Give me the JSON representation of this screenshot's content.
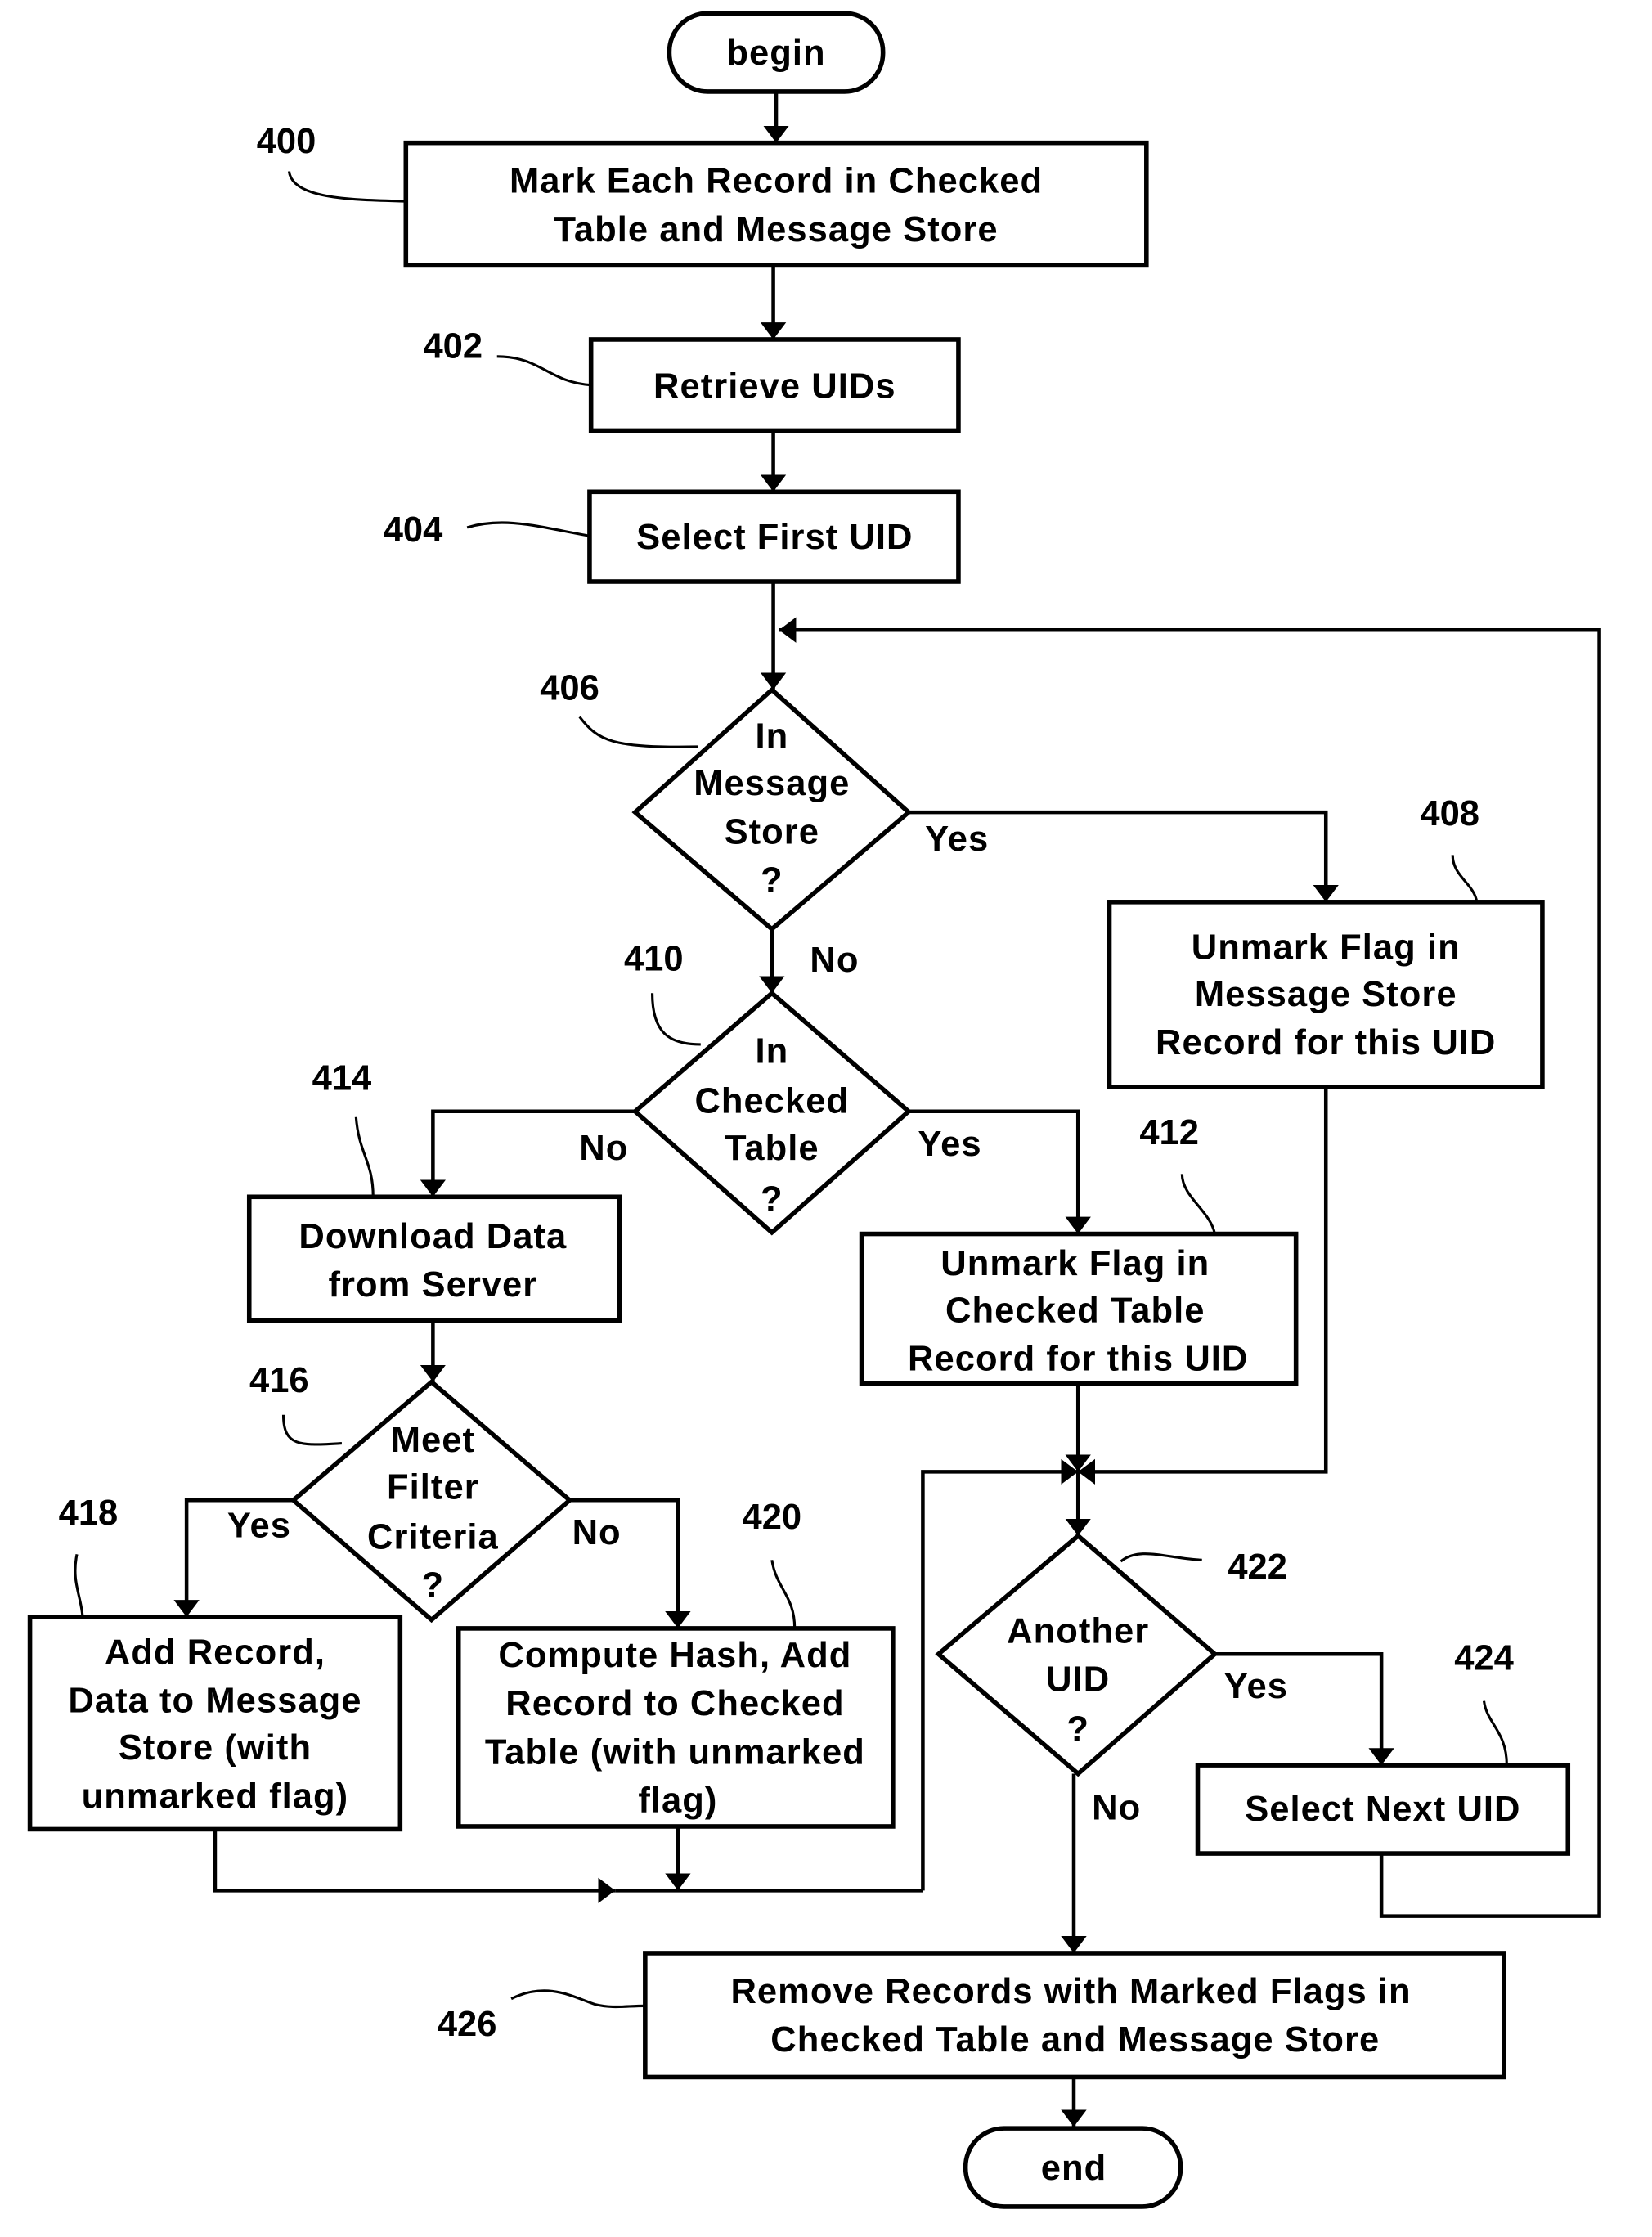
{
  "diagram": {
    "type": "flowchart",
    "nodes": {
      "begin": {
        "kind": "terminal",
        "lines": [
          "begin"
        ]
      },
      "n400": {
        "kind": "process",
        "ref": "400",
        "lines": [
          "Mark Each Record in Checked",
          "Table and Message Store"
        ]
      },
      "n402": {
        "kind": "process",
        "ref": "402",
        "lines": [
          "Retrieve UIDs"
        ]
      },
      "n404": {
        "kind": "process",
        "ref": "404",
        "lines": [
          "Select First UID"
        ]
      },
      "n406": {
        "kind": "decision",
        "ref": "406",
        "lines": [
          "In",
          "Message",
          "Store",
          "?"
        ]
      },
      "n408": {
        "kind": "process",
        "ref": "408",
        "lines": [
          "Unmark Flag in",
          "Message Store",
          "Record for this UID"
        ]
      },
      "n410": {
        "kind": "decision",
        "ref": "410",
        "lines": [
          "In",
          "Checked",
          "Table",
          "?"
        ]
      },
      "n412": {
        "kind": "process",
        "ref": "412",
        "lines": [
          "Unmark Flag in",
          "Checked Table",
          "Record for this UID"
        ]
      },
      "n414": {
        "kind": "process",
        "ref": "414",
        "lines": [
          "Download Data",
          "from Server"
        ]
      },
      "n416": {
        "kind": "decision",
        "ref": "416",
        "lines": [
          "Meet",
          "Filter",
          "Criteria",
          "?"
        ]
      },
      "n418": {
        "kind": "process",
        "ref": "418",
        "lines": [
          "Add Record,",
          "Data to Message",
          "Store (with",
          "unmarked flag)"
        ]
      },
      "n420": {
        "kind": "process",
        "ref": "420",
        "lines": [
          "Compute Hash, Add",
          "Record to Checked",
          "Table (with unmarked",
          "flag)"
        ]
      },
      "n422": {
        "kind": "decision",
        "ref": "422",
        "lines": [
          "Another",
          "UID",
          "?"
        ]
      },
      "n424": {
        "kind": "process",
        "ref": "424",
        "lines": [
          "Select  Next UID"
        ]
      },
      "n426": {
        "kind": "process",
        "ref": "426",
        "lines": [
          "Remove Records with Marked Flags in",
          "Checked Table and Message Store"
        ]
      },
      "end": {
        "kind": "terminal",
        "lines": [
          "end"
        ]
      }
    },
    "edges": [
      {
        "from": "begin",
        "to": "n400",
        "label": ""
      },
      {
        "from": "n400",
        "to": "n402",
        "label": ""
      },
      {
        "from": "n402",
        "to": "n404",
        "label": ""
      },
      {
        "from": "n404",
        "to": "n406",
        "label": ""
      },
      {
        "from": "n406",
        "to": "n408",
        "label": "Yes"
      },
      {
        "from": "n406",
        "to": "n410",
        "label": "No"
      },
      {
        "from": "n410",
        "to": "n412",
        "label": "Yes"
      },
      {
        "from": "n410",
        "to": "n414",
        "label": "No"
      },
      {
        "from": "n414",
        "to": "n416",
        "label": ""
      },
      {
        "from": "n416",
        "to": "n418",
        "label": "Yes"
      },
      {
        "from": "n416",
        "to": "n420",
        "label": "No"
      },
      {
        "from": "n408",
        "to": "n422",
        "label": ""
      },
      {
        "from": "n412",
        "to": "n422",
        "label": ""
      },
      {
        "from": "n418",
        "to": "n422",
        "label": ""
      },
      {
        "from": "n420",
        "to": "n422",
        "label": ""
      },
      {
        "from": "n422",
        "to": "n424",
        "label": "Yes"
      },
      {
        "from": "n422",
        "to": "n426",
        "label": "No"
      },
      {
        "from": "n424",
        "to": "n406",
        "label": ""
      },
      {
        "from": "n426",
        "to": "end",
        "label": ""
      }
    ],
    "edge_labels": {
      "yes": "Yes",
      "no": "No"
    }
  }
}
